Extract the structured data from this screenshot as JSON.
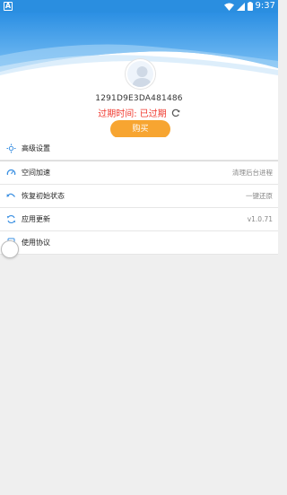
{
  "status_bar": {
    "time": "9:37",
    "icons": [
      "app-a-icon",
      "wifi-icon",
      "signal-icon",
      "battery-icon"
    ]
  },
  "profile": {
    "device_id": "1291D9E3DA481486",
    "expiry_text": "过期时间: 已过期",
    "buy_label": "购买"
  },
  "menu": {
    "items": [
      {
        "label": "高级设置",
        "value": "",
        "icon": "settings-sun-icon"
      },
      {
        "label": "空间加速",
        "value": "清理后台进程",
        "icon": "speedometer-icon"
      },
      {
        "label": "恢复初始状态",
        "value": "一键还原",
        "icon": "undo-icon"
      },
      {
        "label": "应用更新",
        "value": "v1.0.71",
        "icon": "sync-icon"
      },
      {
        "label": "使用协议",
        "value": "",
        "icon": "document-icon"
      }
    ]
  },
  "colors": {
    "primary_blue": "#2a8ee0",
    "expiry_red": "#f0392f",
    "buy_orange": "#f7a531",
    "icon_blue": "#3a8fe2"
  }
}
